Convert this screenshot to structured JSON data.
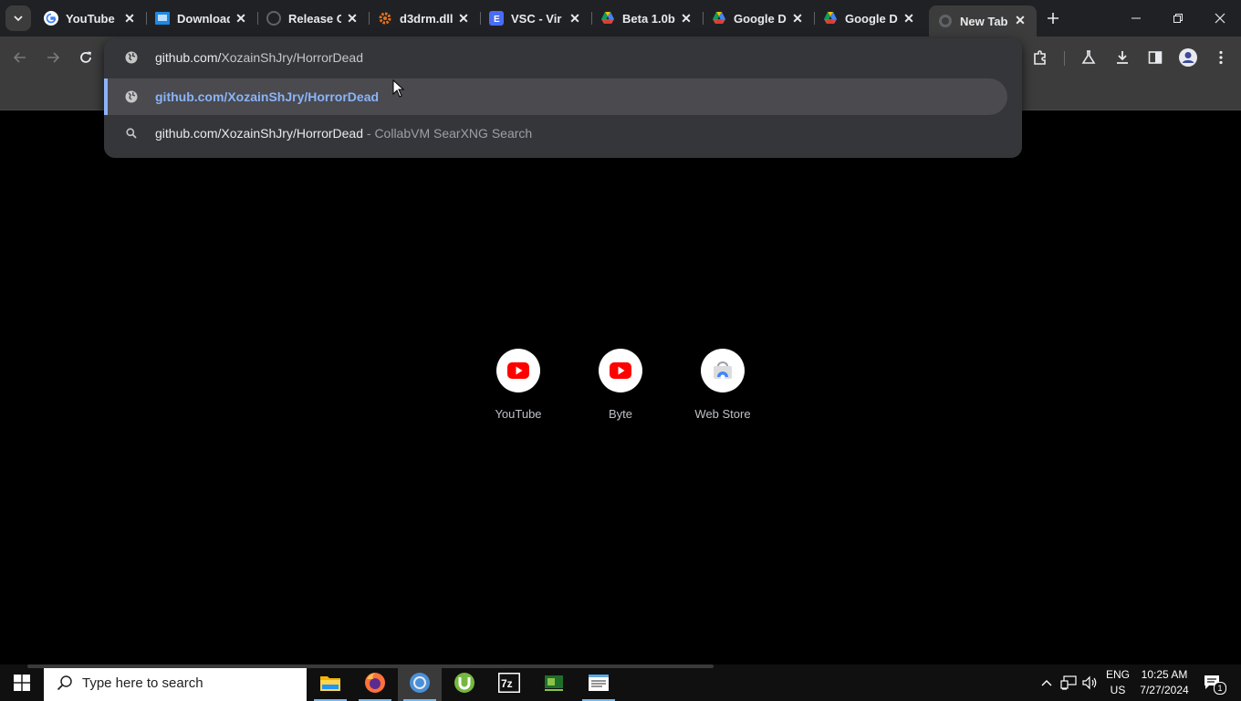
{
  "browser": {
    "tabs": [
      {
        "title": "YouTube",
        "icon": "google-g-icon"
      },
      {
        "title": "Download",
        "icon": "download-site-icon"
      },
      {
        "title": "Release C",
        "icon": "github-icon"
      },
      {
        "title": "d3drm.dll",
        "icon": "gear-icon"
      },
      {
        "title": "VSC - Vir",
        "icon": "vsc-icon"
      },
      {
        "title": "Beta 1.0b",
        "icon": "google-drive-icon"
      },
      {
        "title": "Google D",
        "icon": "google-drive-icon"
      },
      {
        "title": "Google D",
        "icon": "google-drive-icon"
      },
      {
        "title": "New Tab",
        "icon": "globe-icon"
      }
    ],
    "active_tab_index": 8,
    "omnibox": {
      "input_domain": "github.com/",
      "input_path": "XozainShJry/HorrorDead",
      "suggestions": [
        {
          "text": "github.com/XozainShJry/HorrorDead",
          "type": "url",
          "selected": true
        },
        {
          "text": "github.com/XozainShJry/HorrorDead",
          "description": "- CollabVM SearXNG Search",
          "type": "search"
        }
      ]
    },
    "shortcuts": [
      {
        "label": "YouTube",
        "icon": "youtube-icon"
      },
      {
        "label": "Byte",
        "icon": "youtube-icon"
      },
      {
        "label": "Web Store",
        "icon": "web-store-icon"
      }
    ]
  },
  "taskbar": {
    "search_placeholder": "Type here to search",
    "apps": [
      "file-explorer-icon",
      "firefox-icon",
      "chrome-icon",
      "utorrent-icon",
      "7zip-icon",
      "gpu-z-icon",
      "notepad-icon"
    ],
    "language_line1": "ENG",
    "language_line2": "US",
    "time": "10:25 AM",
    "date": "7/27/2024",
    "notification_count": "1"
  },
  "colors": {
    "accent_blue": "#8ab4f8",
    "toolbar_bg": "#3c3c3c",
    "tabstrip_bg": "#202124",
    "taskbar_accent": "#76b9ed"
  }
}
